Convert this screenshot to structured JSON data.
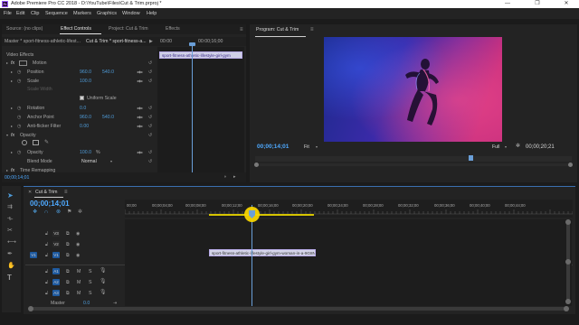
{
  "window": {
    "title": "Adobe Premiere Pro CC 2018 - D:\\YouTube\\Files\\Cut & Trim.prproj *",
    "app_badge": "Pr",
    "minimize": "—",
    "maximize": "❐",
    "close": "✕"
  },
  "menu": [
    "File",
    "Edit",
    "Clip",
    "Sequence",
    "Markers",
    "Graphics",
    "Window",
    "Help"
  ],
  "source_panel": {
    "tabs": [
      "Source: (no clips)",
      "Effect Controls",
      "Project: Cut & Trim",
      "Effects"
    ],
    "active_tab": 1,
    "panel_menu_icon": "≡",
    "header": {
      "master": "Master * sport-fitness-athletic-lifest...",
      "seq": "Cut & Trim * sport-fitness-a...",
      "time_start": "00:00",
      "time_mid": "00:00;16;00",
      "clip_label": "sport-fitness-athletic-lifestyle-girl-gym"
    },
    "video_effects_label": "Video Effects",
    "rows": [
      {
        "name": "Motion",
        "fx": true,
        "expand": "▸"
      },
      {
        "name": "Position",
        "v1": "960.0",
        "v2": "540.0"
      },
      {
        "name": "Scale",
        "v1": "100.0"
      },
      {
        "name": "Scale Width",
        "disabled": true
      },
      {
        "name": "Uniform Scale",
        "checkbox": true
      },
      {
        "name": "Rotation",
        "v1": "0.0"
      },
      {
        "name": "Anchor Point",
        "v1": "960.0",
        "v2": "540.0"
      },
      {
        "name": "Anti-flicker Filter",
        "v1": "0.00"
      },
      {
        "name": "Opacity",
        "fx": true
      },
      {
        "name": "Opacity",
        "v1": "100.0",
        "unit": "%"
      },
      {
        "name": "Blend Mode",
        "select": "Normal"
      },
      {
        "name": "Time Remapping",
        "fx": true
      }
    ],
    "timecode": "00;00;14;01"
  },
  "program_panel": {
    "title": "Program: Cut & Trim",
    "menu_icon": "≡",
    "timecode_current": "00;00;14;01",
    "fit_label": "Fit",
    "quality_label": "Full",
    "wrench_icon": "🔧",
    "timecode_duration": "00;00;20;21",
    "playhead_fraction": 0.68
  },
  "timeline": {
    "tab": "Cut & Trim",
    "close_icon": "✕",
    "menu_icon": "≡",
    "timecode": "00;00;14;01",
    "ruler": [
      "00;00",
      "00;00;04;00",
      "00;00;08;00",
      "00;00;12;00",
      "00;00;16;00",
      "00;00;20;00",
      "00;00;24;00",
      "00;00;28;00",
      "00;00;32;00",
      "00;00;36;00",
      "00;00;40;00",
      "00;00;44;00"
    ],
    "tracks_video": [
      {
        "src": "",
        "name": "V3"
      },
      {
        "src": "",
        "name": "V2"
      },
      {
        "src": "V1",
        "name": "V1"
      }
    ],
    "tracks_audio": [
      {
        "src": "",
        "name": "A1",
        "m": "M",
        "s": "S"
      },
      {
        "src": "",
        "name": "A2",
        "m": "M",
        "s": "S"
      },
      {
        "src": "",
        "name": "A3",
        "m": "M",
        "s": "S"
      }
    ],
    "master": {
      "label": "Master",
      "value": "0.0"
    },
    "clip_label": "sport-fitness-athletic-lifestyle-girl-gym-woman-in-a-9G8NVZ"
  },
  "colors": {
    "accent_blue": "#2d8ceb",
    "playhead": "#6a9fd8",
    "cursor_highlight": "#f5d400",
    "clip_video": "#cfcfe6"
  }
}
